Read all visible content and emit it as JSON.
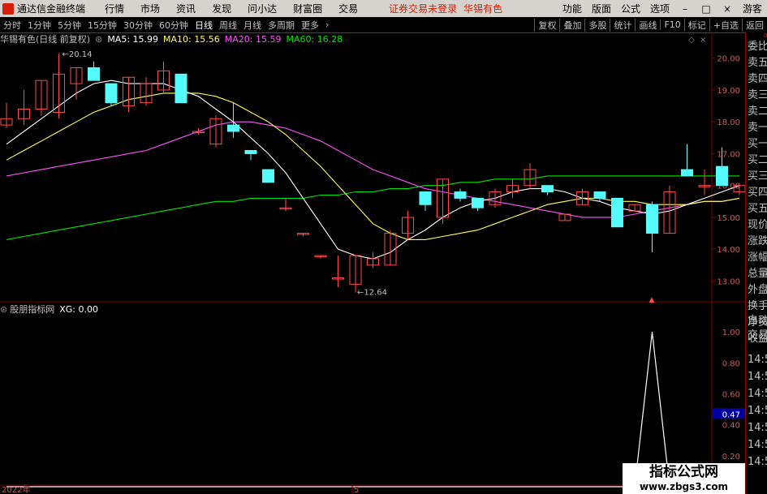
{
  "menubar": {
    "title": "通达信金融终端",
    "items": [
      "行情",
      "市场",
      "资讯",
      "发现",
      "问小达",
      "财富圈",
      "交易"
    ],
    "status": "证券交易未登录",
    "stock": "华锡有色",
    "right_items": [
      "功能",
      "版面",
      "公式",
      "选项"
    ],
    "guest": "游客"
  },
  "toolbar": {
    "periods": [
      "分时",
      "1分钟",
      "5分钟",
      "15分钟",
      "30分钟",
      "60分钟",
      "日线",
      "周线",
      "月线",
      "多周期",
      "更多"
    ],
    "active_period": "日线",
    "right_items": [
      "复权",
      "叠加",
      "多股",
      "统计",
      "画线",
      "F10",
      "标记",
      "+自选",
      "返回"
    ]
  },
  "header": {
    "stock_info": "华锡有色(日线 前复权)",
    "ma5": "MA5: 15.99",
    "ma10": "MA10: 15.56",
    "ma20": "MA20: 15.59",
    "ma60": "MA60: 16.28"
  },
  "sub_header": {
    "indicator": "股朋指标网",
    "value": "XG: 0.00"
  },
  "axis_main": [
    "20.00",
    "19.00",
    "18.00",
    "17.00",
    "16.00",
    "15.00",
    "14.00",
    "13.00"
  ],
  "axis_sub": [
    "1.00",
    "0.80",
    "0.60",
    "0.47",
    "0.40",
    "0.20"
  ],
  "price_marks": {
    "high": "20.14",
    "low": "12.64"
  },
  "date_labels": [
    "2022年",
    "5"
  ],
  "sidepanel": {
    "top": "000",
    "labels": [
      "委比",
      "卖五",
      "卖四",
      "卖三",
      "卖二",
      "卖一",
      "买一",
      "买二",
      "买三",
      "买四",
      "买五",
      "现价",
      "涨跌",
      "涨幅",
      "总量",
      "外盘",
      "换手",
      "净资",
      "收益",
      "自动",
      "交易",
      "14:56",
      "14:56",
      "14:56",
      "14:56",
      "14:56",
      "14:56",
      "14:56"
    ]
  },
  "watermark": {
    "title": "指标公式网",
    "url": "www.zbgs3.com"
  },
  "colors": {
    "up": "#ff4a4a",
    "down": "#54fcfc",
    "ma5": "#ffffff",
    "ma10": "#ffff54",
    "ma20": "#ff54ff",
    "ma60": "#00e600",
    "brand": "#d81e06"
  },
  "chart_data": {
    "type": "candlestick",
    "ylim": [
      12.4,
      20.4
    ],
    "candles": [
      {
        "o": 17.9,
        "h": 18.6,
        "l": 17.8,
        "c": 18.1
      },
      {
        "o": 18.1,
        "h": 19.0,
        "l": 17.9,
        "c": 18.4
      },
      {
        "o": 18.4,
        "h": 19.3,
        "l": 18.2,
        "c": 19.3
      },
      {
        "o": 18.3,
        "h": 20.14,
        "l": 18.1,
        "c": 19.5
      },
      {
        "o": 19.2,
        "h": 19.7,
        "l": 18.7,
        "c": 19.7
      },
      {
        "o": 19.7,
        "h": 19.9,
        "l": 19.3,
        "c": 19.3
      },
      {
        "o": 19.2,
        "h": 19.2,
        "l": 18.5,
        "c": 18.6
      },
      {
        "o": 18.5,
        "h": 19.4,
        "l": 18.3,
        "c": 19.4
      },
      {
        "o": 18.6,
        "h": 19.4,
        "l": 18.5,
        "c": 19.2
      },
      {
        "o": 19.0,
        "h": 19.9,
        "l": 18.9,
        "c": 19.6
      },
      {
        "o": 19.5,
        "h": 19.5,
        "l": 18.6,
        "c": 18.6
      },
      {
        "o": 17.7,
        "h": 17.8,
        "l": 17.6,
        "c": 17.7
      },
      {
        "o": 17.3,
        "h": 18.2,
        "l": 17.2,
        "c": 18.1
      },
      {
        "o": 17.9,
        "h": 18.6,
        "l": 17.5,
        "c": 17.7
      },
      {
        "o": 17.1,
        "h": 17.1,
        "l": 16.8,
        "c": 17.0
      },
      {
        "o": 16.5,
        "h": 16.5,
        "l": 16.1,
        "c": 16.1
      },
      {
        "o": 15.3,
        "h": 15.6,
        "l": 15.2,
        "c": 15.3
      },
      {
        "o": 14.5,
        "h": 14.5,
        "l": 14.4,
        "c": 14.5
      },
      {
        "o": 13.8,
        "h": 13.8,
        "l": 13.7,
        "c": 13.8
      },
      {
        "o": 13.1,
        "h": 13.8,
        "l": 12.8,
        "c": 13.1
      },
      {
        "o": 12.9,
        "h": 13.8,
        "l": 12.64,
        "c": 13.8
      },
      {
        "o": 13.5,
        "h": 13.9,
        "l": 13.4,
        "c": 13.7
      },
      {
        "o": 13.5,
        "h": 14.6,
        "l": 13.5,
        "c": 14.5
      },
      {
        "o": 14.5,
        "h": 15.2,
        "l": 14.3,
        "c": 15.0
      },
      {
        "o": 15.8,
        "h": 15.8,
        "l": 15.2,
        "c": 15.4
      },
      {
        "o": 15.0,
        "h": 16.2,
        "l": 14.8,
        "c": 16.2
      },
      {
        "o": 15.8,
        "h": 15.9,
        "l": 15.5,
        "c": 15.6
      },
      {
        "o": 15.6,
        "h": 15.6,
        "l": 15.2,
        "c": 15.3
      },
      {
        "o": 15.4,
        "h": 15.9,
        "l": 15.3,
        "c": 15.8
      },
      {
        "o": 15.8,
        "h": 16.2,
        "l": 15.6,
        "c": 16.0
      },
      {
        "o": 16.0,
        "h": 16.7,
        "l": 15.9,
        "c": 16.5
      },
      {
        "o": 16.0,
        "h": 16.0,
        "l": 15.7,
        "c": 15.8
      },
      {
        "o": 14.9,
        "h": 15.1,
        "l": 14.9,
        "c": 15.1
      },
      {
        "o": 15.4,
        "h": 15.9,
        "l": 15.4,
        "c": 15.8
      },
      {
        "o": 15.8,
        "h": 15.8,
        "l": 15.5,
        "c": 15.6
      },
      {
        "o": 15.6,
        "h": 15.6,
        "l": 14.7,
        "c": 14.7
      },
      {
        "o": 15.2,
        "h": 15.4,
        "l": 15.2,
        "c": 15.4
      },
      {
        "o": 15.4,
        "h": 15.5,
        "l": 13.9,
        "c": 14.5
      },
      {
        "o": 14.5,
        "h": 16.0,
        "l": 14.5,
        "c": 15.8
      },
      {
        "o": 16.5,
        "h": 17.3,
        "l": 16.3,
        "c": 16.3
      },
      {
        "o": 16.0,
        "h": 16.5,
        "l": 15.7,
        "c": 16.0
      },
      {
        "o": 16.6,
        "h": 17.2,
        "l": 16.0,
        "c": 16.0
      },
      {
        "o": 15.8,
        "h": 16.0,
        "l": 15.7,
        "c": 16.0
      }
    ],
    "ma5": [
      17.3,
      17.7,
      18.1,
      18.5,
      18.9,
      19.2,
      19.3,
      19.2,
      19.2,
      19.2,
      19.0,
      18.8,
      18.4,
      18.0,
      17.5,
      17.0,
      16.4,
      15.6,
      14.8,
      14.0,
      13.8,
      13.7,
      13.9,
      14.3,
      14.6,
      15.0,
      15.3,
      15.5,
      15.6,
      15.8,
      15.9,
      15.9,
      15.8,
      15.6,
      15.5,
      15.3,
      15.2,
      15.1,
      15.2,
      15.4,
      15.6,
      15.8,
      16.0
    ],
    "ma10": [
      16.8,
      17.1,
      17.4,
      17.7,
      18.0,
      18.3,
      18.5,
      18.7,
      18.8,
      18.9,
      18.9,
      18.9,
      18.8,
      18.6,
      18.3,
      18.0,
      17.6,
      17.1,
      16.6,
      16.0,
      15.4,
      14.8,
      14.5,
      14.3,
      14.3,
      14.4,
      14.5,
      14.6,
      14.8,
      15.0,
      15.2,
      15.4,
      15.5,
      15.6,
      15.6,
      15.5,
      15.5,
      15.4,
      15.4,
      15.4,
      15.5,
      15.5,
      15.6
    ],
    "ma20": [
      16.3,
      16.4,
      16.5,
      16.6,
      16.7,
      16.8,
      16.9,
      17.0,
      17.1,
      17.3,
      17.5,
      17.7,
      17.9,
      18.0,
      18.0,
      17.9,
      17.8,
      17.6,
      17.4,
      17.1,
      16.8,
      16.5,
      16.3,
      16.1,
      15.9,
      15.8,
      15.7,
      15.6,
      15.5,
      15.4,
      15.3,
      15.2,
      15.1,
      15.0,
      15.0,
      15.0,
      15.1,
      15.2,
      15.3,
      15.4,
      15.5,
      15.5,
      15.6
    ],
    "ma60": [
      14.3,
      14.4,
      14.5,
      14.6,
      14.7,
      14.8,
      14.9,
      15.0,
      15.1,
      15.2,
      15.3,
      15.4,
      15.5,
      15.5,
      15.6,
      15.6,
      15.6,
      15.6,
      15.7,
      15.7,
      15.8,
      15.8,
      15.9,
      15.9,
      16.0,
      16.0,
      16.1,
      16.1,
      16.2,
      16.2,
      16.2,
      16.3,
      16.3,
      16.3,
      16.3,
      16.3,
      16.3,
      16.3,
      16.3,
      16.3,
      16.3,
      16.3,
      16.3
    ],
    "xg": [
      0,
      0,
      0,
      0,
      0,
      0,
      0,
      0,
      0,
      0,
      0,
      0,
      0,
      0,
      0,
      0,
      0,
      0,
      0,
      0,
      0,
      0,
      0,
      0,
      0,
      0,
      0,
      0,
      0,
      0,
      0,
      0,
      0,
      0,
      0,
      0,
      0,
      1,
      0,
      0,
      0,
      0,
      0
    ],
    "sub_ylim": [
      0,
      1.1
    ]
  }
}
